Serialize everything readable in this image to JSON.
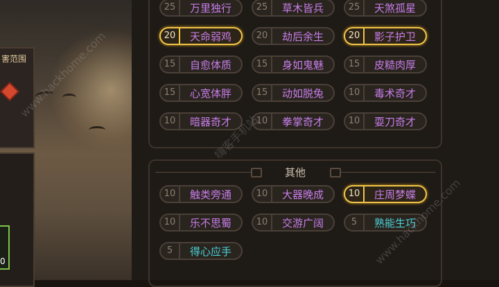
{
  "left_panel": {
    "label": "害范围",
    "value": "0"
  },
  "section_other": {
    "title": "其他"
  },
  "talents_top": [
    {
      "level": "25",
      "name": "万里独行",
      "selected": false,
      "color": "#c77ee8"
    },
    {
      "level": "25",
      "name": "草木皆兵",
      "selected": false,
      "color": "#c77ee8"
    },
    {
      "level": "25",
      "name": "天煞孤星",
      "selected": false,
      "color": "#c77ee8"
    },
    {
      "level": "20",
      "name": "天命弱鸡",
      "selected": true,
      "color": "#c77ee8"
    },
    {
      "level": "20",
      "name": "劫后余生",
      "selected": false,
      "color": "#c77ee8"
    },
    {
      "level": "20",
      "name": "影子护卫",
      "selected": true,
      "color": "#c77ee8"
    },
    {
      "level": "15",
      "name": "自愈体质",
      "selected": false,
      "color": "#c77ee8"
    },
    {
      "level": "15",
      "name": "身如鬼魅",
      "selected": false,
      "color": "#c77ee8"
    },
    {
      "level": "15",
      "name": "皮糙肉厚",
      "selected": false,
      "color": "#c77ee8"
    },
    {
      "level": "15",
      "name": "心宽体胖",
      "selected": false,
      "color": "#c77ee8"
    },
    {
      "level": "15",
      "name": "动如脱兔",
      "selected": false,
      "color": "#c77ee8"
    },
    {
      "level": "10",
      "name": "毒术奇才",
      "selected": false,
      "color": "#c77ee8"
    },
    {
      "level": "10",
      "name": "暗器奇才",
      "selected": false,
      "color": "#c77ee8"
    },
    {
      "level": "10",
      "name": "拳掌奇才",
      "selected": false,
      "color": "#c77ee8"
    },
    {
      "level": "10",
      "name": "耍刀奇才",
      "selected": false,
      "color": "#c77ee8"
    }
  ],
  "talents_other": [
    {
      "level": "10",
      "name": "触类旁通",
      "selected": false,
      "color": "#c77ee8"
    },
    {
      "level": "10",
      "name": "大器晚成",
      "selected": false,
      "color": "#c77ee8"
    },
    {
      "level": "10",
      "name": "庄周梦蝶",
      "selected": true,
      "color": "#c77ee8"
    },
    {
      "level": "10",
      "name": "乐不思蜀",
      "selected": false,
      "color": "#c77ee8"
    },
    {
      "level": "10",
      "name": "交游广阔",
      "selected": false,
      "color": "#c77ee8"
    },
    {
      "level": "5",
      "name": "熟能生巧",
      "selected": false,
      "color": "#4ad0d6"
    },
    {
      "level": "5",
      "name": "得心应手",
      "selected": false,
      "color": "#4ad0d6"
    }
  ],
  "watermarks": [
    "www.hackhome.com",
    "嗨客手机站",
    "www.hackhome.com"
  ]
}
